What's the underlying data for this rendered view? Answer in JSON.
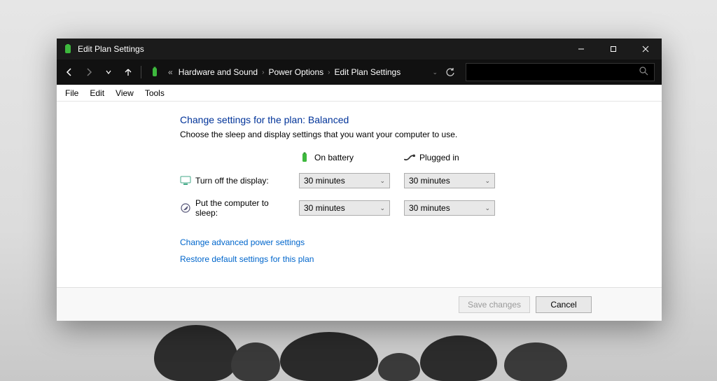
{
  "window": {
    "title": "Edit Plan Settings"
  },
  "breadcrumb": {
    "items": [
      "Hardware and Sound",
      "Power Options",
      "Edit Plan Settings"
    ]
  },
  "menubar": {
    "items": [
      "File",
      "Edit",
      "View",
      "Tools"
    ]
  },
  "page": {
    "heading": "Change settings for the plan: Balanced",
    "subtext": "Choose the sleep and display settings that you want your computer to use.",
    "col_battery": "On battery",
    "col_plugged": "Plugged in",
    "row_display": "Turn off the display:",
    "row_sleep": "Put the computer to sleep:",
    "display_battery": "30 minutes",
    "display_plugged": "30 minutes",
    "sleep_battery": "30 minutes",
    "sleep_plugged": "30 minutes",
    "link_advanced": "Change advanced power settings",
    "link_restore": "Restore default settings for this plan"
  },
  "footer": {
    "save": "Save changes",
    "cancel": "Cancel"
  }
}
